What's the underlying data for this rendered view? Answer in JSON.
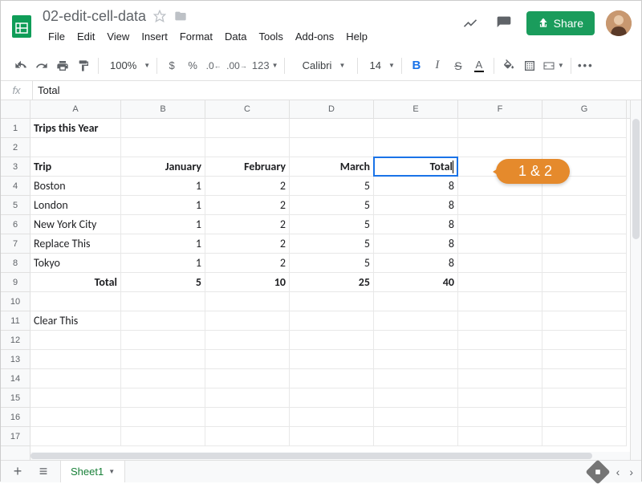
{
  "doc": {
    "title": "02-edit-cell-data"
  },
  "menu": [
    "File",
    "Edit",
    "View",
    "Insert",
    "Format",
    "Data",
    "Tools",
    "Add-ons",
    "Help"
  ],
  "share": {
    "label": "Share"
  },
  "toolbar": {
    "zoom": "100%",
    "format123": "123",
    "font": "Calibri",
    "fontsize": "14"
  },
  "formula": {
    "fx": "fx",
    "value": "Total"
  },
  "columns": [
    "A",
    "B",
    "C",
    "D",
    "E",
    "F",
    "G"
  ],
  "rows": [
    "1",
    "2",
    "3",
    "4",
    "5",
    "6",
    "7",
    "8",
    "9",
    "10",
    "11",
    "12",
    "13",
    "14",
    "15",
    "16",
    "17"
  ],
  "grid": {
    "r1": {
      "a": "Trips this Year"
    },
    "r3": {
      "a": "Trip",
      "b": "January",
      "c": "February",
      "d": "March",
      "e_edit": "Total"
    },
    "r4": {
      "a": "Boston",
      "b": "1",
      "c": "2",
      "d": "5",
      "e": "8"
    },
    "r5": {
      "a": "London",
      "b": "1",
      "c": "2",
      "d": "5",
      "e": "8"
    },
    "r6": {
      "a": "New York City",
      "b": "1",
      "c": "2",
      "d": "5",
      "e": "8"
    },
    "r7": {
      "a": "Replace This",
      "b": "1",
      "c": "2",
      "d": "5",
      "e": "8"
    },
    "r8": {
      "a": "Tokyo",
      "b": "1",
      "c": "2",
      "d": "5",
      "e": "8"
    },
    "r9": {
      "a": "Total",
      "b": "5",
      "c": "10",
      "d": "25",
      "e": "40"
    },
    "r11": {
      "a": "Clear This"
    }
  },
  "callout": {
    "text": "1 & 2"
  },
  "sheet_tab": {
    "name": "Sheet1"
  }
}
